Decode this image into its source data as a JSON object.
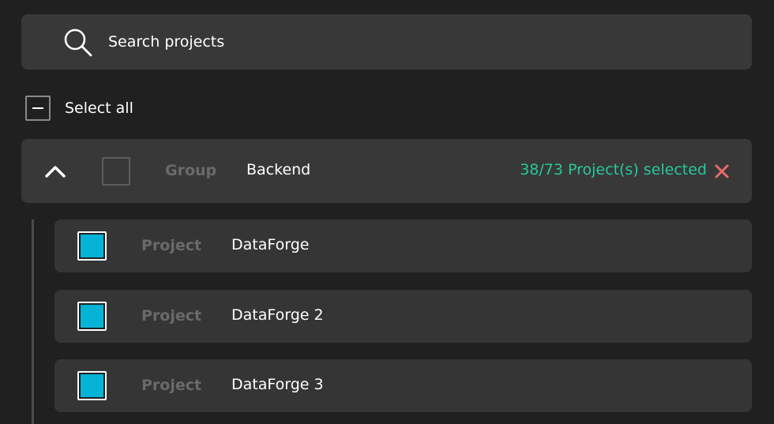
{
  "search": {
    "placeholder": "Search projects",
    "icon": "search-icon"
  },
  "select_all": {
    "label": "Select all",
    "state": "indeterminate"
  },
  "group": {
    "type_label": "Group",
    "name": "Backend",
    "expanded": true,
    "checked": false,
    "selection_status": "38/73 Project(s) selected",
    "status_color": "#26c99a",
    "clear_color": "#e96a6a"
  },
  "projects": [
    {
      "type_label": "Project",
      "name": "DataForge",
      "checked": true
    },
    {
      "type_label": "Project",
      "name": "DataForge 2",
      "checked": true
    },
    {
      "type_label": "Project",
      "name": "DataForge 3",
      "checked": true
    }
  ],
  "colors": {
    "background": "#202020",
    "panel": "#383838",
    "row": "#353535",
    "checkbox_checked": "#04b3d6",
    "muted_text": "#6a6a6a"
  }
}
